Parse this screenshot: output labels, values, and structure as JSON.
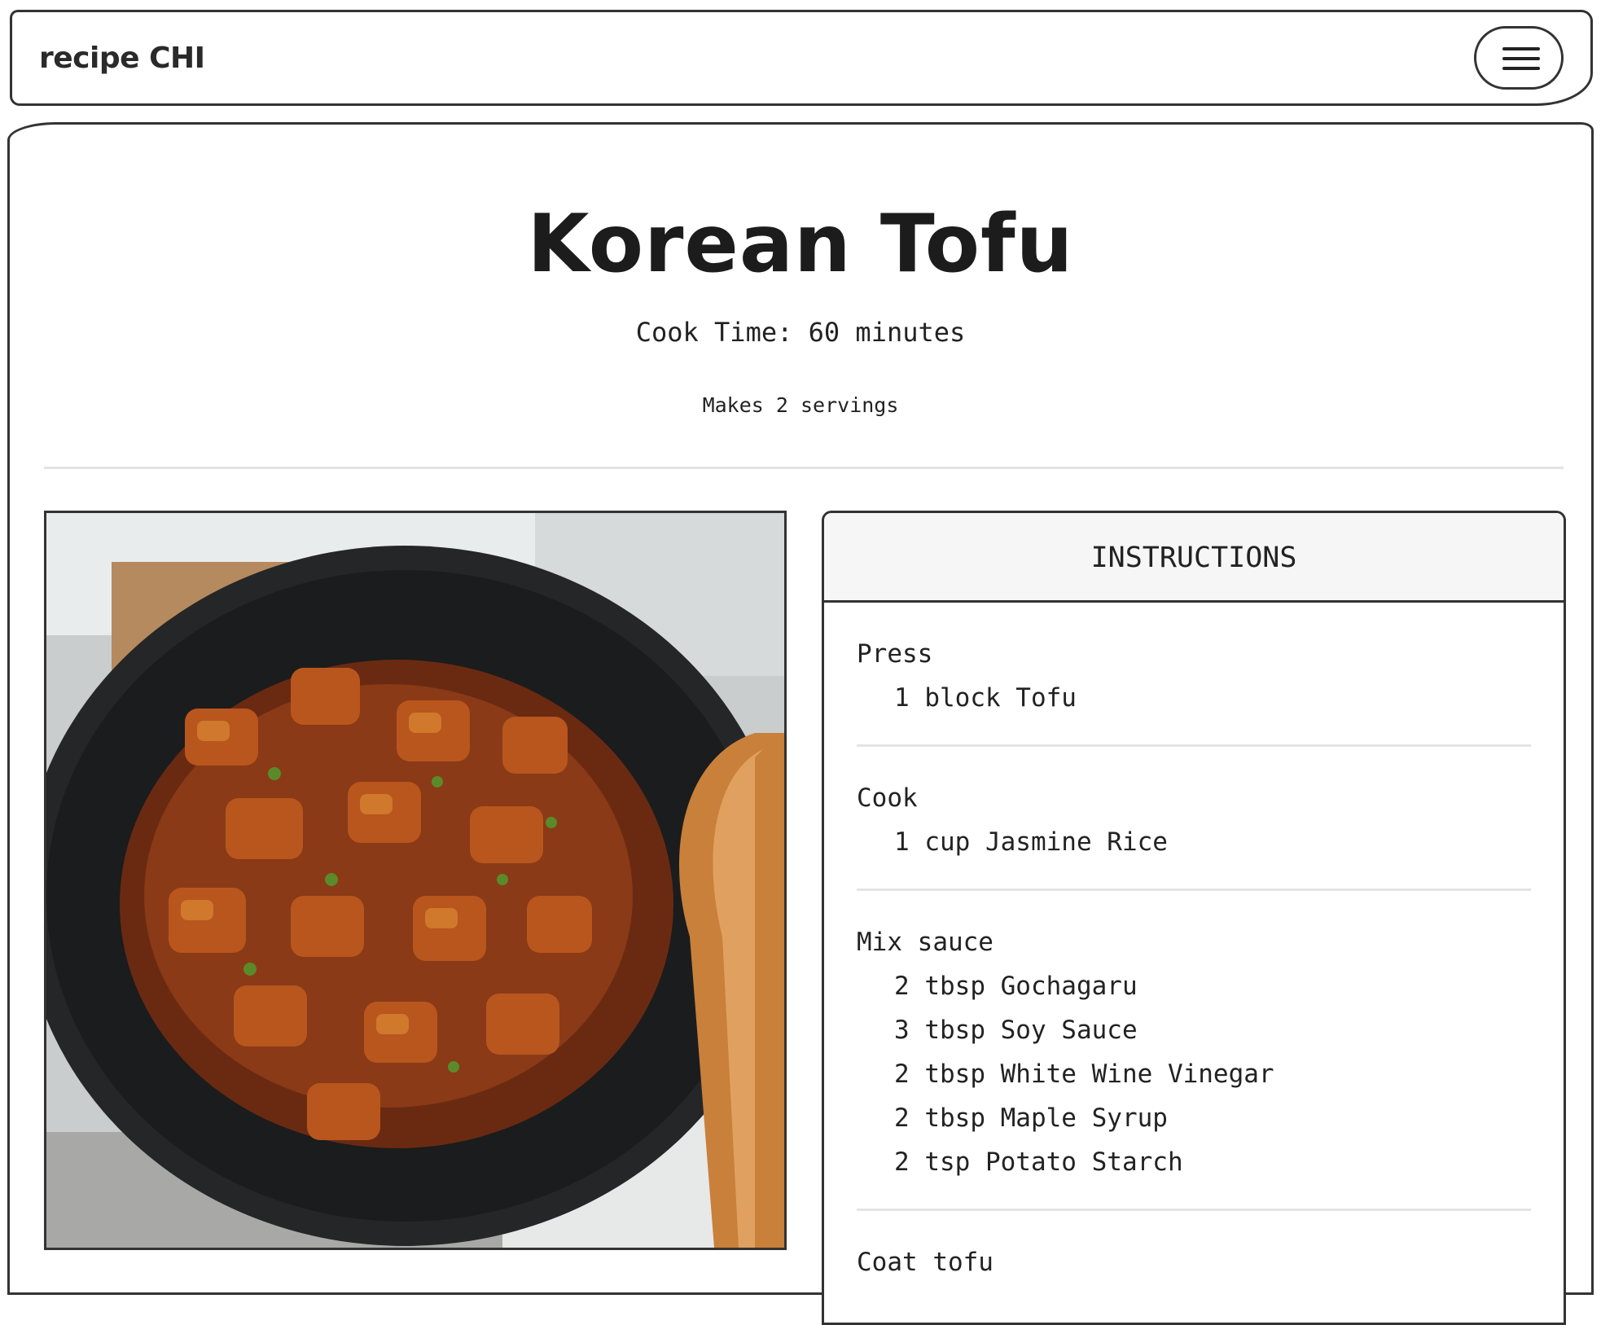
{
  "navbar": {
    "brand": "recipe CHI",
    "menu_icon": "hamburger-menu-icon"
  },
  "recipe": {
    "title": "Korean Tofu",
    "cook_time": "Cook Time: 60 minutes",
    "servings": "Makes 2 servings",
    "image_icon": "tofu-dish-photo"
  },
  "instructions": {
    "header": "INSTRUCTIONS",
    "steps": [
      {
        "name": "Press",
        "ingredients": [
          "1 block Tofu"
        ]
      },
      {
        "name": "Cook",
        "ingredients": [
          "1 cup Jasmine Rice"
        ]
      },
      {
        "name": "Mix sauce",
        "ingredients": [
          "2 tbsp Gochagaru",
          "3 tbsp Soy Sauce",
          "2 tbsp White Wine Vinegar",
          "2 tbsp Maple Syrup",
          "2 tsp Potato Starch"
        ]
      },
      {
        "name": "Coat tofu",
        "ingredients": []
      }
    ]
  }
}
